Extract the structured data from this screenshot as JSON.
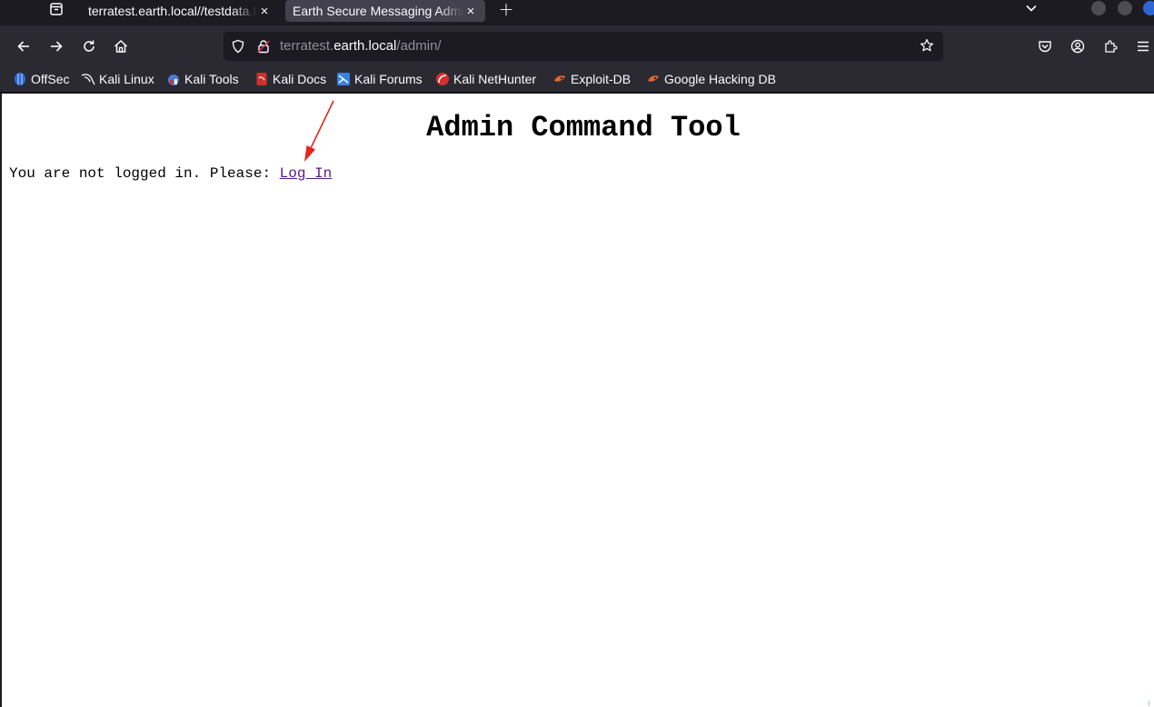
{
  "tabs": [
    {
      "title": "terratest.earth.local//testdata.txt",
      "active": false
    },
    {
      "title": "Earth Secure Messaging Admin",
      "active": true
    }
  ],
  "tab_close_glyph": "×",
  "new_tab_glyph": "+",
  "url": {
    "scheme_prefix": "terratest.",
    "host": "earth.local",
    "path": "/admin/"
  },
  "bookmarks": [
    {
      "label": "OffSec",
      "icon": "offsec-icon",
      "color": "#2f6bd6"
    },
    {
      "label": "Kali Linux",
      "icon": "kali-dragon-icon",
      "color": "#fbfbfe"
    },
    {
      "label": "Kali Tools",
      "icon": "kali-tools-icon",
      "color": "#4b7bd8"
    },
    {
      "label": "Kali Docs",
      "icon": "kali-docs-icon",
      "color": "#d0312d"
    },
    {
      "label": "Kali Forums",
      "icon": "kali-forums-icon",
      "color": "#3b82e0"
    },
    {
      "label": "Kali NetHunter",
      "icon": "kali-nethunter-icon",
      "color": "#d0312d"
    },
    {
      "label": "Exploit-DB",
      "icon": "exploit-db-icon",
      "color": "#e8652b"
    },
    {
      "label": "Google Hacking DB",
      "icon": "ghdb-icon",
      "color": "#e8652b"
    }
  ],
  "page": {
    "title": "Admin Command Tool",
    "login_prompt": "You are not logged in. Please: ",
    "login_link": "Log In"
  },
  "colors": {
    "toolbar": "#2b2a33",
    "tabstrip": "#1c1b22",
    "active_tab": "#42414d",
    "visited_link": "#551a8b",
    "annotation_arrow": "#e8231b"
  }
}
